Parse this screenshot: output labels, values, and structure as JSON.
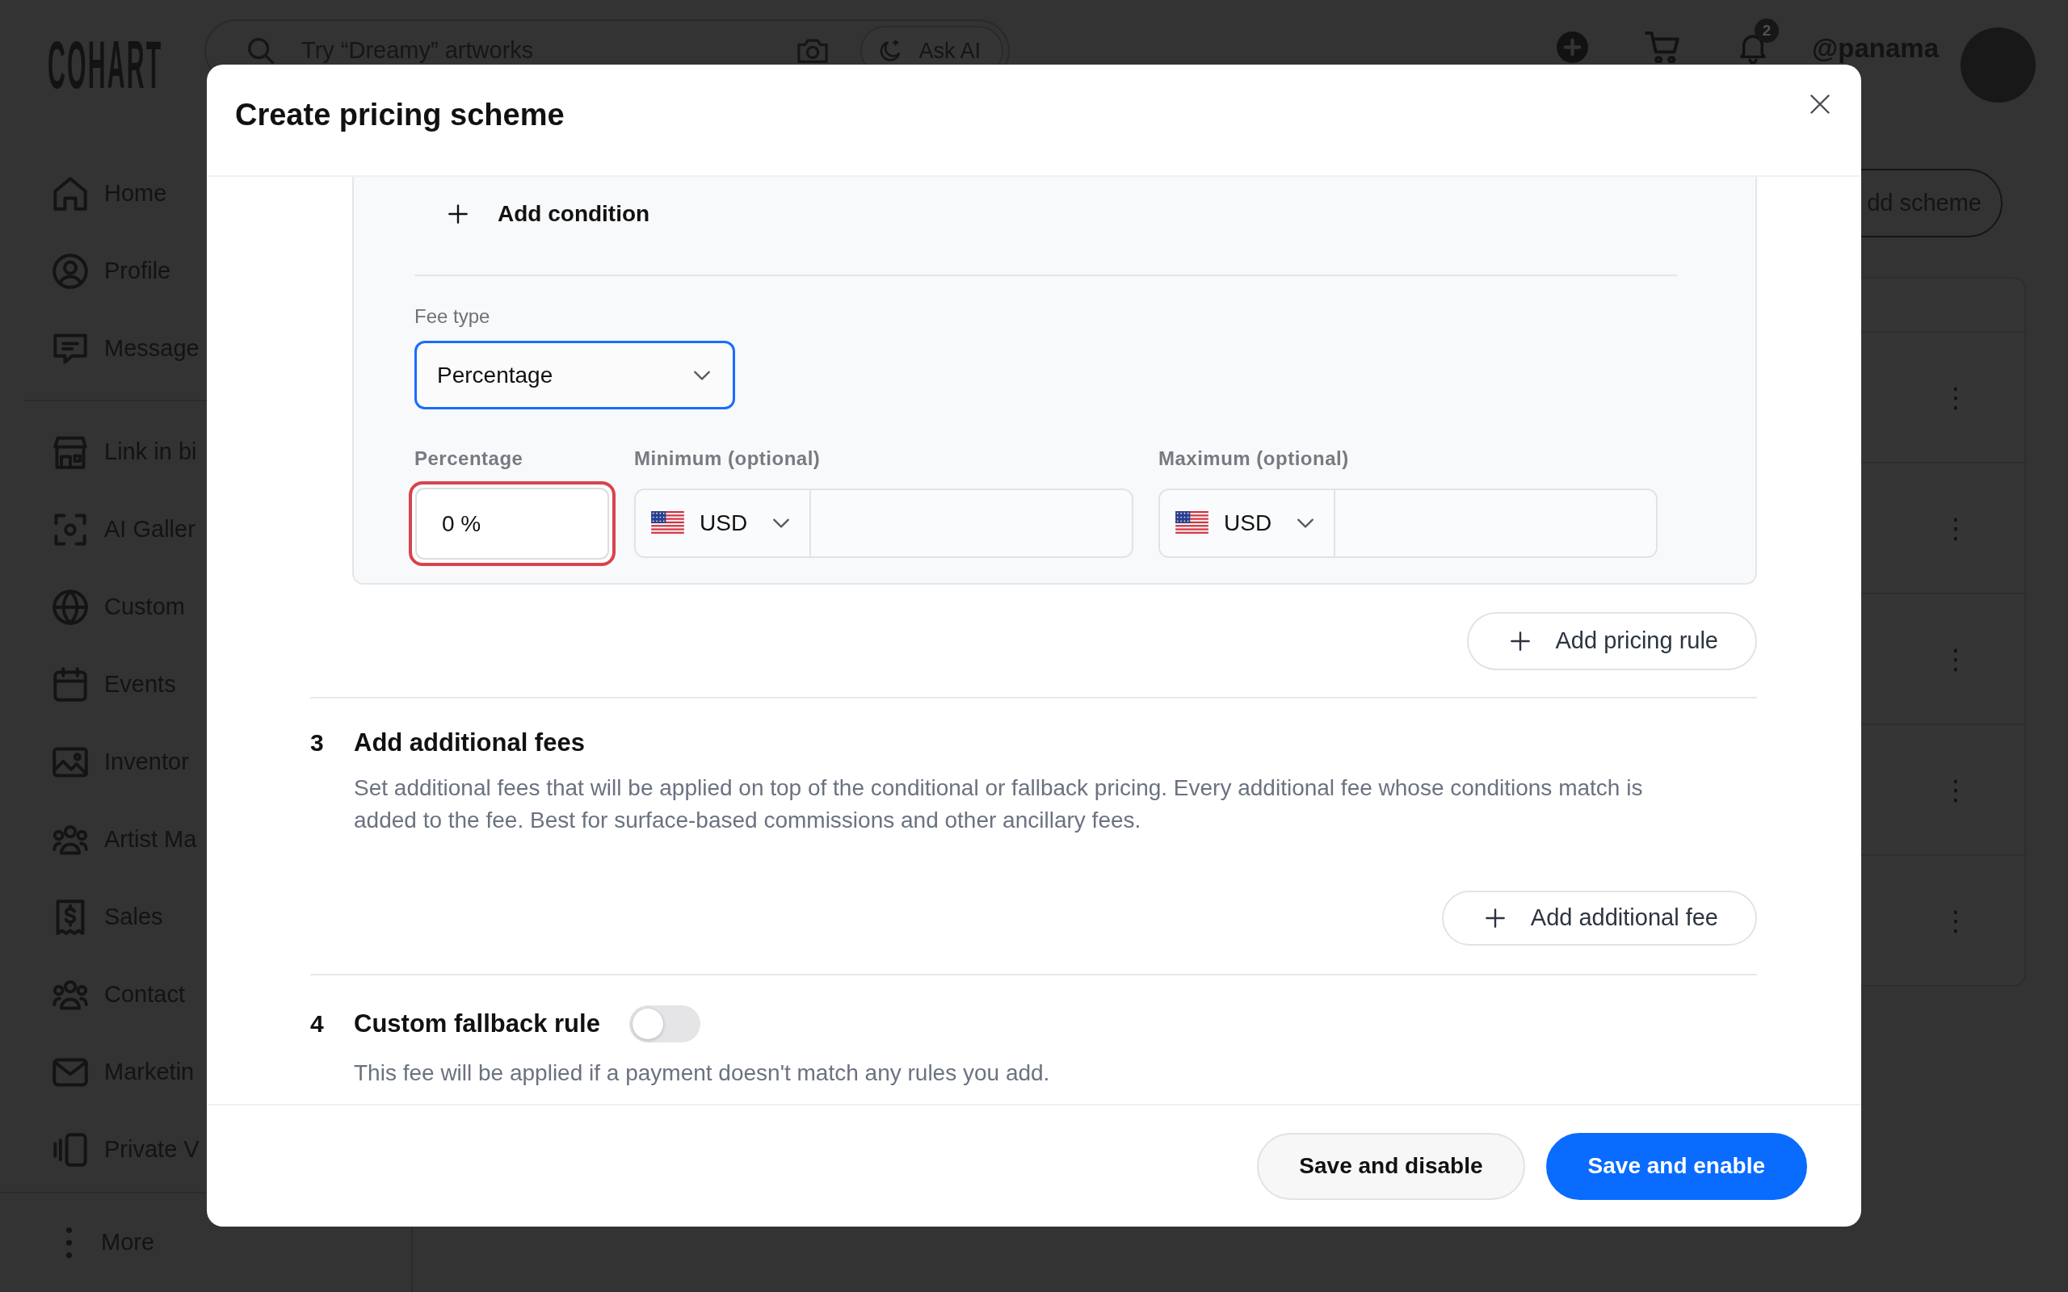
{
  "topbar": {
    "logo": "COHART",
    "search": {
      "placeholder": "Try “Dreamy” artworks"
    },
    "ask_ai": "Ask AI",
    "notification_count": "2",
    "username": "@panama"
  },
  "sidebar": {
    "groups": [
      {
        "items": [
          {
            "label": "Home"
          },
          {
            "label": "Profile"
          },
          {
            "label": "Message"
          }
        ]
      },
      {
        "items": [
          {
            "label": "Link in bi"
          },
          {
            "label": "AI Galler"
          },
          {
            "label": "Custom"
          },
          {
            "label": "Events"
          },
          {
            "label": "Inventor"
          },
          {
            "label": "Artist Ma"
          },
          {
            "label": "Sales"
          },
          {
            "label": "Contact"
          },
          {
            "label": "Marketin"
          },
          {
            "label": "Private V"
          }
        ]
      }
    ],
    "more": "More"
  },
  "main": {
    "add_scheme_button": "dd scheme",
    "table": {
      "rows": [
        {
          "menu": "⋮"
        },
        {
          "menu": "⋮"
        },
        {
          "menu": "⋮"
        },
        {
          "menu": "⋮"
        },
        {
          "menu": "⋮"
        }
      ]
    }
  },
  "modal": {
    "title": "Create pricing scheme",
    "rule": {
      "add_condition": "Add condition",
      "fee_type": {
        "label": "Fee type",
        "value": "Percentage",
        "focused": true
      },
      "fields": [
        {
          "kind": "percent",
          "label": "Percentage",
          "value": "0 %",
          "invalid": true
        },
        {
          "kind": "amount",
          "label": "Minimum (optional)",
          "currency": "USD"
        },
        {
          "kind": "amount",
          "label": "Maximum (optional)",
          "currency": "USD"
        }
      ]
    },
    "add_pricing_rule": "Add pricing rule",
    "sections": [
      {
        "number": "3",
        "title": "Add additional fees",
        "description": "Set additional fees that will be applied on top of the conditional or fallback pricing. Every additional fee whose conditions match is added to the fee. Best for surface-based commissions and other ancillary fees.",
        "button": "Add additional fee"
      },
      {
        "number": "4",
        "title": "Custom fallback rule",
        "toggle": {
          "on": false
        },
        "description": "This fee will be applied if a payment doesn't match any rules you add."
      }
    ],
    "footer": {
      "buttons": [
        {
          "label": "Save and disable",
          "kind": "secondary"
        },
        {
          "label": "Save and enable",
          "kind": "primary"
        }
      ]
    }
  }
}
